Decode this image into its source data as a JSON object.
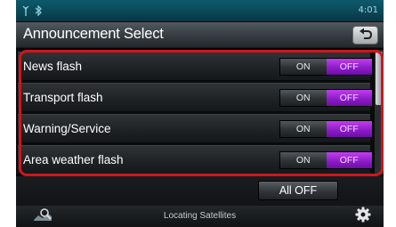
{
  "status_bar": {
    "clock": "4:01",
    "icons": [
      "antenna-icon",
      "bluetooth-icon"
    ]
  },
  "header": {
    "title": "Announcement Select",
    "back_icon": "return-arrow-icon"
  },
  "announcements": [
    {
      "label": "News flash",
      "on_label": "ON",
      "off_label": "OFF",
      "selected": "OFF"
    },
    {
      "label": "Transport flash",
      "on_label": "ON",
      "off_label": "OFF",
      "selected": "OFF"
    },
    {
      "label": "Warning/Service",
      "on_label": "ON",
      "off_label": "OFF",
      "selected": "OFF"
    },
    {
      "label": "Area weather flash",
      "on_label": "ON",
      "off_label": "OFF",
      "selected": "OFF"
    }
  ],
  "actions": {
    "all_off_label": "All OFF"
  },
  "nav": {
    "status_text": "Locating Satellites",
    "left_icon": "map-search-icon",
    "right_icon": "gear-icon"
  },
  "colors": {
    "off_selected": "#9a22d6",
    "highlight": "#d0151c",
    "status_bar": "#0a4656"
  }
}
